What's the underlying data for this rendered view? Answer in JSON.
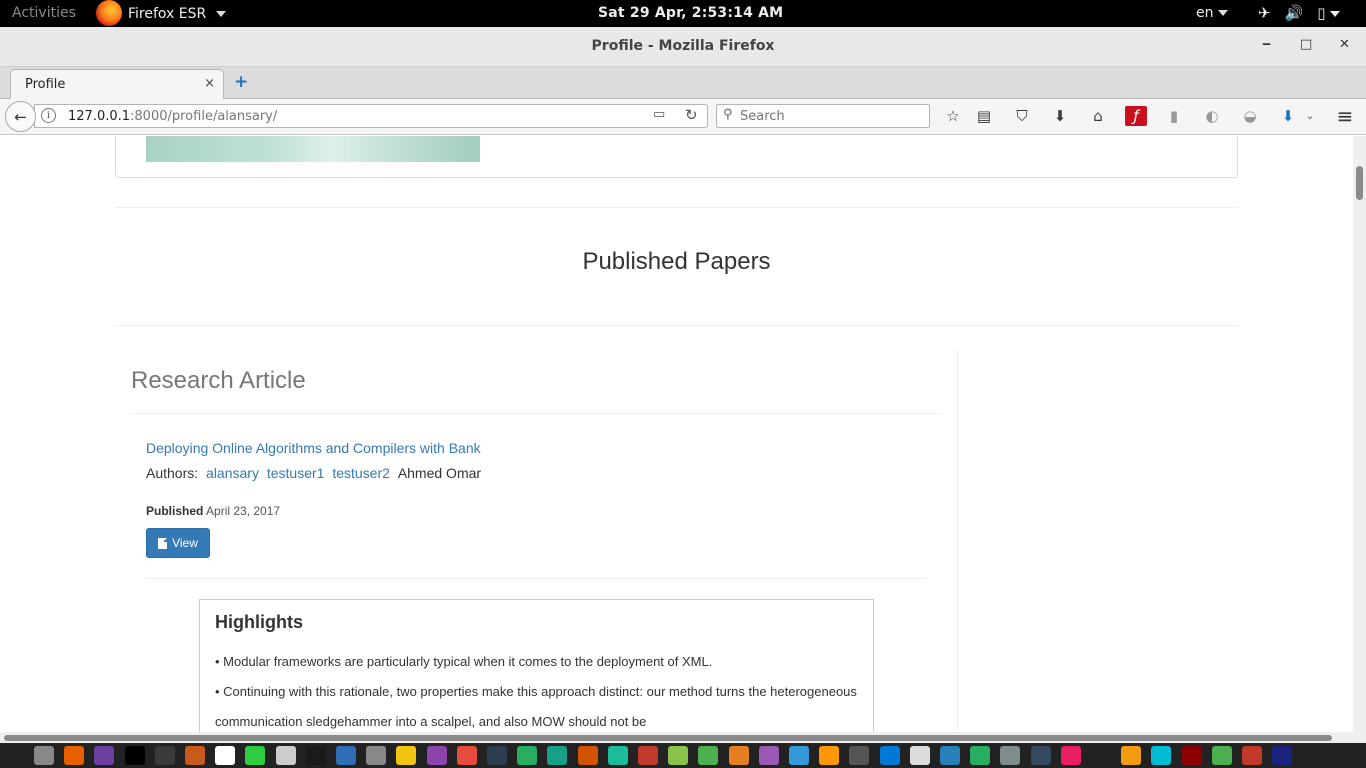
{
  "gnome": {
    "activities": "Activities",
    "app_name": "Firefox ESR",
    "clock": "Sat 29 Apr,  2:53:14 AM",
    "lang": "en",
    "tray_icons": [
      "airplane-icon",
      "volume-icon",
      "battery-icon"
    ]
  },
  "window": {
    "title": "Profile - Mozilla Firefox",
    "minimize": "‒",
    "maximize": "□",
    "close": "✕"
  },
  "tabs": [
    {
      "label": "Profile",
      "close": "×"
    }
  ],
  "newtab": "+",
  "nav": {
    "back": "←",
    "url_host": "127.0.0.1",
    "url_rest": ":8000/profile/alansary/",
    "reader": "▭",
    "reload": "↻",
    "search_placeholder": "Search"
  },
  "toolbar_icons": [
    {
      "name": "bookmark-star-icon",
      "glyph": "☆"
    },
    {
      "name": "reading-list-icon",
      "glyph": "▤"
    },
    {
      "name": "pocket-icon",
      "glyph": "⛉"
    },
    {
      "name": "download-icon",
      "glyph": "⬇"
    },
    {
      "name": "home-icon",
      "glyph": "⌂"
    },
    {
      "name": "flash-icon",
      "glyph": "ƒ"
    },
    {
      "name": "extension-icon",
      "glyph": "▮"
    },
    {
      "name": "extension2-icon",
      "glyph": "◐"
    },
    {
      "name": "extension3-icon",
      "glyph": "◒"
    },
    {
      "name": "downloader-icon",
      "glyph": "⬇"
    },
    {
      "name": "hamburger-menu-icon",
      "glyph": "≡"
    }
  ],
  "page": {
    "section_title": "Published Papers",
    "category": "Research Article",
    "paper": {
      "title": "Deploying Online Algorithms and Compilers with Bank",
      "authors_label": "Authors:",
      "authors_links": [
        "alansary",
        "testuser1",
        "testuser2"
      ],
      "authors_plain": "Ahmed Omar",
      "published_label": "Published",
      "published_date": "April 23, 2017",
      "view_label": "View"
    },
    "highlights": {
      "heading": "Highlights",
      "items": [
        "• Modular frameworks are particularly typical when it comes to the deployment of XML.",
        "• Continuing with this rationale, two properties make this approach distinct: our method turns the heterogeneous communication sledgehammer into a scalpel, and also MOW should not be"
      ]
    }
  },
  "dock_colors": [
    "#888888",
    "#e66000",
    "#6a3fa0",
    "#000000",
    "#3a3a3a",
    "#c85a1e",
    "#ffffff",
    "#2ecc40",
    "#cccccc",
    "#1a1a1a",
    "#2f6db5",
    "#888888",
    "#f1c40f",
    "#8e44ad",
    "#e74c3c",
    "#2c3e50",
    "#27ae60",
    "#16a085",
    "#d35400",
    "#1abc9c",
    "#c0392b",
    "#8bc34a",
    "#4caf50",
    "#e67e22",
    "#9b59b6",
    "#3498db",
    "#ff9800",
    "#555555",
    "#0078d7",
    "#dddddd",
    "#2980b9",
    "#27ae60",
    "#7f8c8d",
    "#34495e",
    "#e91e63",
    "#222222",
    "#f39c12",
    "#00bcd4",
    "#8e0000",
    "#4caf50",
    "#c0392b",
    "#1a237e"
  ]
}
